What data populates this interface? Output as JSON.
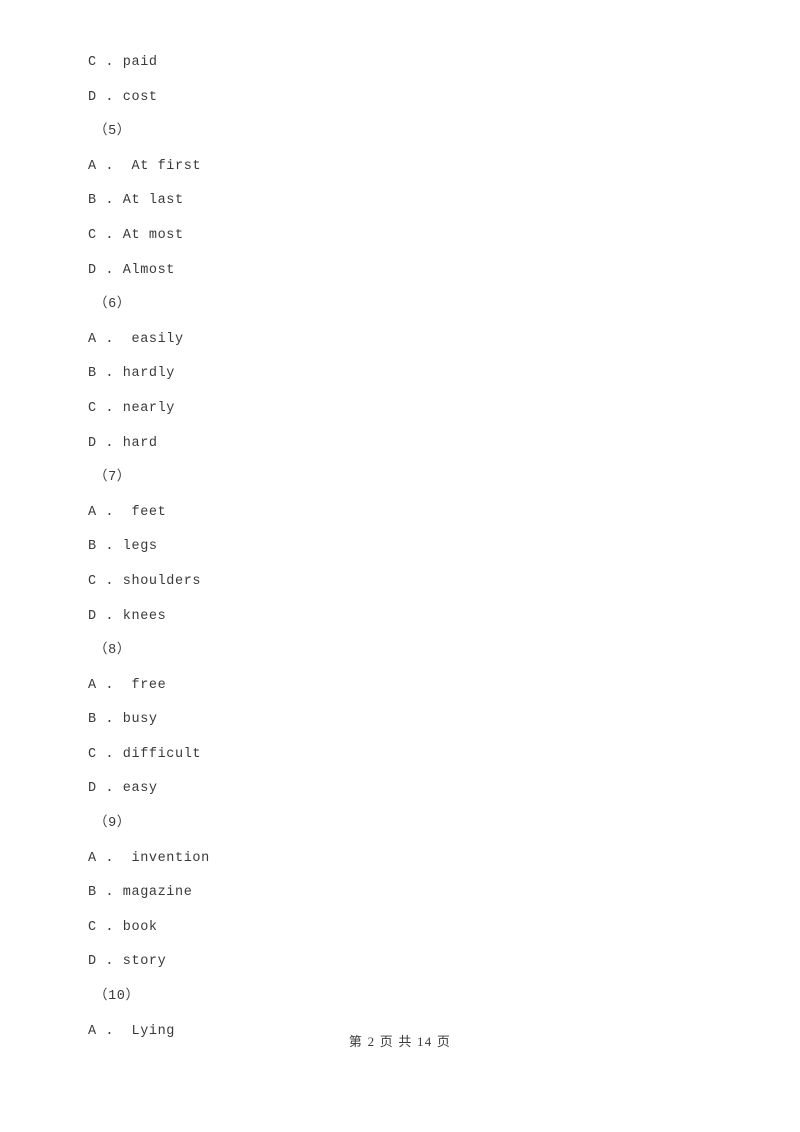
{
  "document": {
    "type": "exam-paper",
    "background_color": "#ffffff",
    "text_color": "#3a3a3a"
  },
  "lines": [
    {
      "kind": "option",
      "text": "C . paid"
    },
    {
      "kind": "option",
      "text": "D . cost"
    },
    {
      "kind": "question-number",
      "text": "（5）"
    },
    {
      "kind": "option",
      "text": "A .  At first"
    },
    {
      "kind": "option",
      "text": "B . At last"
    },
    {
      "kind": "option",
      "text": "C . At most"
    },
    {
      "kind": "option",
      "text": "D . Almost"
    },
    {
      "kind": "question-number",
      "text": "（6）"
    },
    {
      "kind": "option",
      "text": "A .  easily"
    },
    {
      "kind": "option",
      "text": "B . hardly"
    },
    {
      "kind": "option",
      "text": "C . nearly"
    },
    {
      "kind": "option",
      "text": "D . hard"
    },
    {
      "kind": "question-number",
      "text": "（7）"
    },
    {
      "kind": "option",
      "text": "A .  feet"
    },
    {
      "kind": "option",
      "text": "B . legs"
    },
    {
      "kind": "option",
      "text": "C . shoulders"
    },
    {
      "kind": "option",
      "text": "D . knees"
    },
    {
      "kind": "question-number",
      "text": "（8）"
    },
    {
      "kind": "option",
      "text": "A .  free"
    },
    {
      "kind": "option",
      "text": "B . busy"
    },
    {
      "kind": "option",
      "text": "C . difficult"
    },
    {
      "kind": "option",
      "text": "D . easy"
    },
    {
      "kind": "question-number",
      "text": "（9）"
    },
    {
      "kind": "option",
      "text": "A .  invention"
    },
    {
      "kind": "option",
      "text": "B . magazine"
    },
    {
      "kind": "option",
      "text": "C . book"
    },
    {
      "kind": "option",
      "text": "D . story"
    },
    {
      "kind": "question-number",
      "text": "（10）"
    },
    {
      "kind": "option",
      "text": "A .  Lying"
    }
  ],
  "footer": {
    "text": "第 2 页 共 14 页",
    "current_page": "2",
    "total_pages": "14"
  }
}
